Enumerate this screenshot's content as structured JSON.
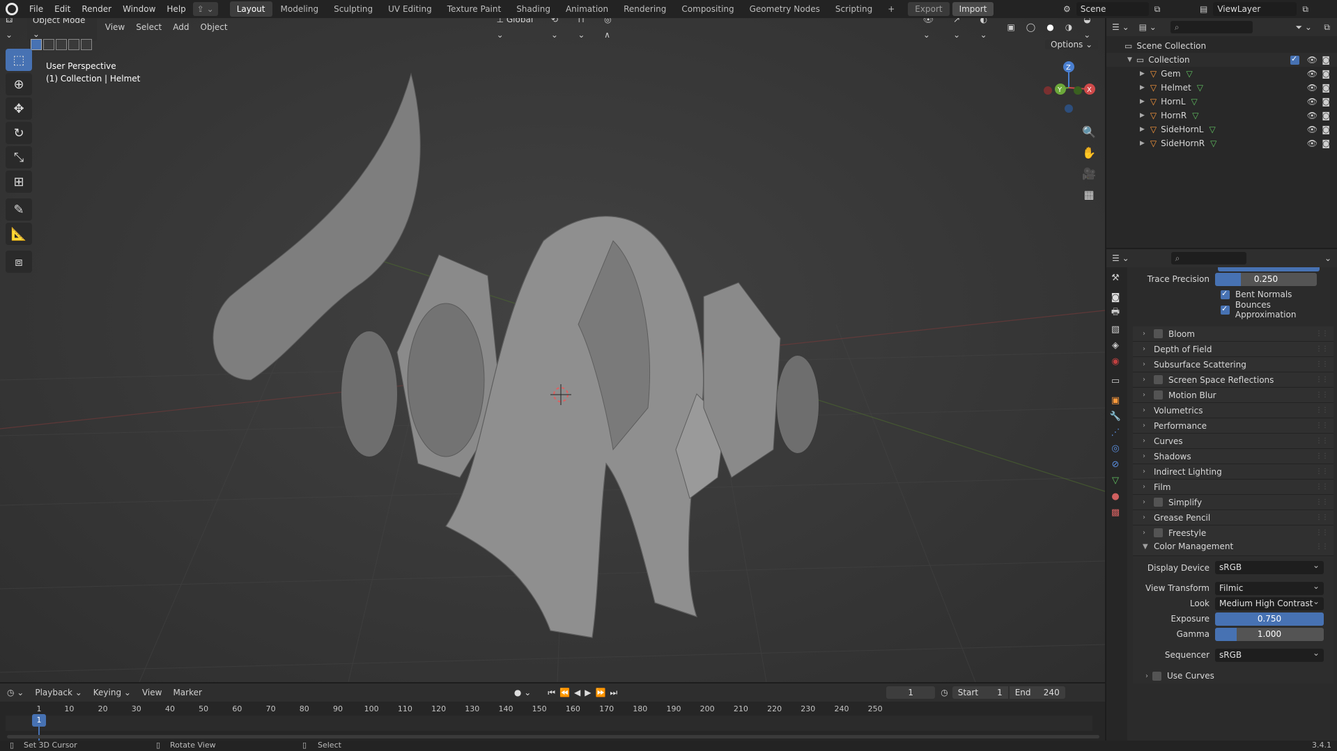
{
  "menu": [
    "File",
    "Edit",
    "Render",
    "Window",
    "Help"
  ],
  "workspaces": [
    "Layout",
    "Modeling",
    "Sculpting",
    "UV Editing",
    "Texture Paint",
    "Shading",
    "Animation",
    "Rendering",
    "Compositing",
    "Geometry Nodes",
    "Scripting"
  ],
  "active_workspace": "Layout",
  "top_actions": {
    "export": "Export",
    "import": "Import",
    "add": "+"
  },
  "scene": {
    "name": "Scene",
    "view_layer": "ViewLayer"
  },
  "viewport": {
    "mode": "Object Mode",
    "menus": [
      "View",
      "Select",
      "Add",
      "Object"
    ],
    "orientation": "Global",
    "options_label": "Options",
    "perspective_label": "User Perspective",
    "active_object_label": "(1) Collection | Helmet",
    "gizmo_axes": [
      "Z",
      "Y",
      "X"
    ]
  },
  "outliner": {
    "scene_collection": "Scene Collection",
    "collection": "Collection",
    "objects": [
      "Gem",
      "Helmet",
      "HornL",
      "HornR",
      "SideHornL",
      "SideHornR"
    ]
  },
  "properties": {
    "trace_precision_label": "Trace Precision",
    "trace_precision_value": "0.250",
    "trace_precision_fill": 0.25,
    "checks": [
      {
        "label": "Bent Normals",
        "checked": true
      },
      {
        "label": "Bounces Approximation",
        "checked": true
      }
    ],
    "sections": [
      {
        "label": "Bloom",
        "checkbox": true
      },
      {
        "label": "Depth of Field",
        "checkbox": false
      },
      {
        "label": "Subsurface Scattering",
        "checkbox": false
      },
      {
        "label": "Screen Space Reflections",
        "checkbox": true
      },
      {
        "label": "Motion Blur",
        "checkbox": true
      },
      {
        "label": "Volumetrics",
        "checkbox": false
      },
      {
        "label": "Performance",
        "checkbox": false
      },
      {
        "label": "Curves",
        "checkbox": false
      },
      {
        "label": "Shadows",
        "checkbox": false
      },
      {
        "label": "Indirect Lighting",
        "checkbox": false
      },
      {
        "label": "Film",
        "checkbox": false
      },
      {
        "label": "Simplify",
        "checkbox": true
      },
      {
        "label": "Grease Pencil",
        "checkbox": false
      },
      {
        "label": "Freestyle",
        "checkbox": true
      }
    ],
    "color_management": {
      "title": "Color Management",
      "display_device_label": "Display Device",
      "display_device": "sRGB",
      "view_transform_label": "View Transform",
      "view_transform": "Filmic",
      "look_label": "Look",
      "look": "Medium High Contrast",
      "exposure_label": "Exposure",
      "exposure": "0.750",
      "gamma_label": "Gamma",
      "gamma": "1.000",
      "sequencer_label": "Sequencer",
      "sequencer": "sRGB",
      "use_curves_label": "Use Curves"
    }
  },
  "timeline": {
    "menus": [
      "Playback",
      "Keying",
      "View",
      "Marker"
    ],
    "current_frame": "1",
    "start_label": "Start",
    "start": "1",
    "end_label": "End",
    "end": "240",
    "ticks": [
      "1",
      "10",
      "20",
      "30",
      "40",
      "50",
      "60",
      "70",
      "80",
      "90",
      "100",
      "110",
      "120",
      "130",
      "140",
      "150",
      "160",
      "170",
      "180",
      "190",
      "200",
      "210",
      "220",
      "230",
      "240",
      "250"
    ]
  },
  "statusbar": {
    "set_cursor": "Set 3D Cursor",
    "rotate": "Rotate View",
    "select": "Select",
    "version": "3.4.1"
  }
}
